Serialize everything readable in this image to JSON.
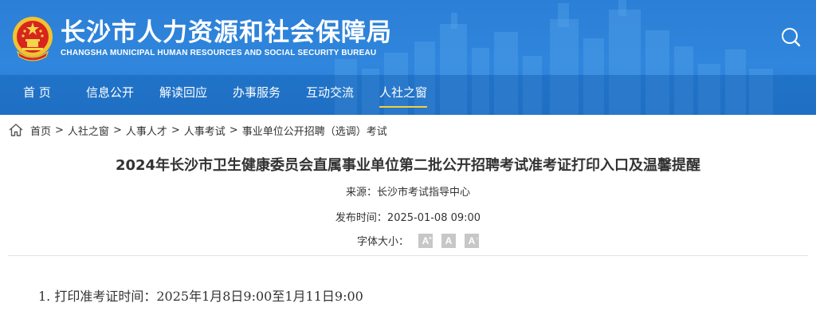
{
  "header": {
    "title_cn": "长沙市人力资源和社会保障局",
    "title_en": "CHANGSHA MUNICIPAL HUMAN RESOURCES AND SOCIAL SECURITY BUREAU",
    "logo_icon": "national-emblem-icon",
    "search_icon": "search-icon",
    "colors": {
      "header_bg": "#2f86dc",
      "nav_active_underline": "#f4d03f"
    }
  },
  "nav": {
    "items": [
      {
        "label": "首 页"
      },
      {
        "label": "信息公开"
      },
      {
        "label": "解读回应"
      },
      {
        "label": "办事服务"
      },
      {
        "label": "互动交流"
      },
      {
        "label": "人社之窗",
        "active": true
      }
    ]
  },
  "breadcrumb": {
    "home_icon": "home-icon",
    "items": [
      "首页",
      "人社之窗",
      "人事人才",
      "人事考试",
      "事业单位公开招聘（选调）考试"
    ],
    "separator": ">"
  },
  "article": {
    "title": "2024年长沙市卫生健康委员会直属事业单位第二批公开招聘考试准考证打印入口及温馨提醒",
    "source": "来源：长沙市考试指导中心",
    "published": "发布时间：2025-01-08 09:00",
    "font_size_label": "字体大小：",
    "font_size_buttons": [
      "A",
      "A",
      "A"
    ],
    "body_first_line": "1. 打印准考证时间：2025年1月8日9:00至1月11日9:00"
  }
}
